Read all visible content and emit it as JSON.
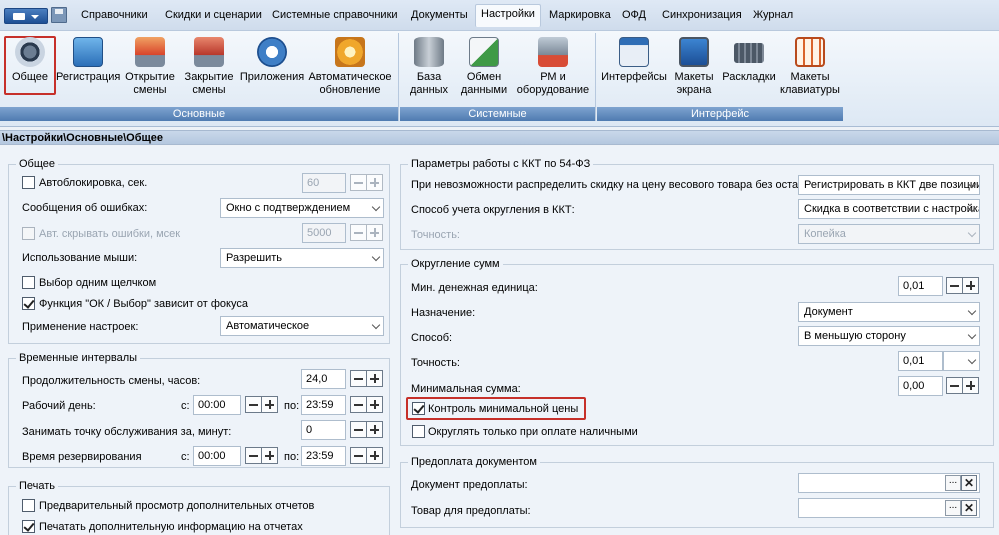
{
  "menu": {
    "items": [
      "Справочники",
      "Скидки и сценарии",
      "Системные справочники",
      "Документы",
      "Настройки",
      "Маркировка",
      "ОФД",
      "Синхронизация",
      "Журнал"
    ],
    "active": "Настройки"
  },
  "ribbon": {
    "groups": [
      {
        "label": "Основные",
        "buttons": [
          {
            "label": "Общее",
            "icon": "settings-dial-icon"
          },
          {
            "label": "Регистрация",
            "icon": "registration-icon"
          },
          {
            "label": "Открытие\nсмены",
            "icon": "open-shift-icon"
          },
          {
            "label": "Закрытие\nсмены",
            "icon": "close-shift-icon"
          },
          {
            "label": "Приложения",
            "icon": "star-icon"
          },
          {
            "label": "Автоматическое\nобновление",
            "icon": "auto-update-icon"
          }
        ]
      },
      {
        "label": "Системные",
        "buttons": [
          {
            "label": "База\nданных",
            "icon": "database-icon"
          },
          {
            "label": "Обмен\nданными",
            "icon": "data-exchange-icon"
          },
          {
            "label": "РМ и\nоборудование",
            "icon": "workstation-icon"
          }
        ]
      },
      {
        "label": "Интерфейс",
        "buttons": [
          {
            "label": "Интерфейсы",
            "icon": "dialog-ok-icon"
          },
          {
            "label": "Макеты\nэкрана",
            "icon": "monitor-icon"
          },
          {
            "label": "Раскладки",
            "icon": "keyboard-icon"
          },
          {
            "label": "Макеты\nклавиатуры",
            "icon": "keypad-icon"
          }
        ]
      }
    ]
  },
  "path": "\\Настройки\\Основные\\Общее",
  "general": {
    "title": "Общее",
    "autolock_label": "Автоблокировка, сек.",
    "autolock_value": "60",
    "errors_label": "Сообщения об ошибках:",
    "errors_value": "Окно с подтверждением",
    "autohide_label": "Авт. скрывать ошибки, мсек",
    "autohide_value": "5000",
    "mouse_label": "Использование мыши:",
    "mouse_value": "Разрешить",
    "single_click_label": "Выбор одним щелчком",
    "ok_focus_label": "Функция \"ОК / Выбор\" зависит от фокуса",
    "apply_label": "Применение настроек:",
    "apply_value": "Автоматическое"
  },
  "intervals": {
    "title": "Временные интервалы",
    "shift_label": "Продолжительность смены, часов:",
    "shift_value": "24,0",
    "workday_label": "Рабочий день:",
    "from_label": "с:",
    "to_label": "по:",
    "workday_from": "00:00",
    "workday_to": "23:59",
    "occupy_label": "Занимать точку обслуживания за, минут:",
    "occupy_value": "0",
    "reserve_label": "Время резервирования",
    "reserve_from": "00:00",
    "reserve_to": "23:59"
  },
  "print": {
    "title": "Печать",
    "preview_label": "Предварительный просмотр дополнительных отчетов",
    "extra_label": "Печатать дополнительную информацию на отчетах"
  },
  "kkt": {
    "title": "Параметры работы с ККТ по 54-ФЗ",
    "discount_label": "При невозможности распределить скидку на цену весового товара без остатка:",
    "discount_value": "Регистрировать в ККТ две позиции",
    "rounding_label": "Способ учета округления в ККТ:",
    "rounding_value": "Скидка в соответствии с настройками",
    "precision_label": "Точность:",
    "precision_value": "Копейка"
  },
  "round": {
    "title": "Округление сумм",
    "min_unit_label": "Мин. денежная единица:",
    "min_unit_value": "0,01",
    "purpose_label": "Назначение:",
    "purpose_value": "Документ",
    "method_label": "Способ:",
    "method_value": "В меньшую сторону",
    "precision_label": "Точность:",
    "precision_value": "0,01",
    "min_sum_label": "Минимальная сумма:",
    "min_sum_value": "0,00",
    "min_price_label": "Контроль минимальной цены",
    "cash_only_label": "Округлять только при оплате наличными"
  },
  "prepay": {
    "title": "Предоплата документом",
    "doc_label": "Документ предоплаты:",
    "goods_label": "Товар для предоплаты:",
    "pick_glyph": "...",
    "clear_glyph": "✕"
  }
}
